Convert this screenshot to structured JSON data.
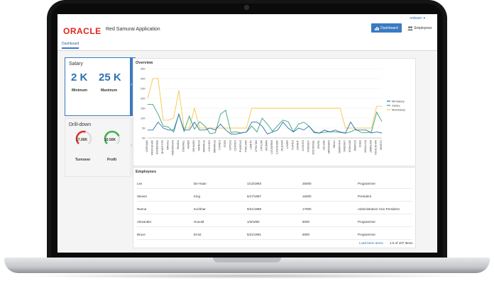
{
  "header": {
    "logo_text": "ORACLE",
    "app_title": "Red Samurai Application",
    "user": "redsam",
    "dashboard_button": "Dashboard",
    "employees_button": "Employees"
  },
  "tabs": {
    "active": "Dashboard"
  },
  "salary": {
    "title": "Salary",
    "minimum_value": "2 K",
    "minimum_label": "Minimum",
    "maximum_value": "25 K",
    "maximum_label": "Maximum"
  },
  "drilldown": {
    "title": "Drill-down",
    "turnover_value": "17.00K",
    "turnover_label": "Turnover",
    "turnover_level": 0.55,
    "profit_value": "10.50K",
    "profit_label": "Profit",
    "profit_level": 0.75
  },
  "chart_data": {
    "type": "line",
    "title": "Overview",
    "ylim": [
      0,
      35000
    ],
    "yticks": [
      "0K",
      "5K",
      "10K",
      "15K",
      "20K",
      "25K",
      "30K",
      "35K"
    ],
    "categories": [
      "LDEHAAN",
      "WKOCHHAR",
      "NGREENBE",
      "BHARTSTE",
      "IMIKKILI",
      "KMOURGOS",
      "SBAIDA",
      "SSEWALL",
      "HBAER",
      "JWHALEN",
      "MWEISS",
      "AMARKLE",
      "KCHUNG",
      "MMARKLE",
      "VJONES",
      "GGEE",
      "SSTILES",
      "CDAVIES",
      "PVARGAS",
      "PWILSON",
      "LSMITH",
      "LPHILTAN",
      "JTAYLOR",
      "SKUMAR",
      "LOCKERKE",
      "CJOHNSON",
      "JFLEAUR",
      "LOZER",
      "TGATES",
      "JGRANT",
      "JLIVINGS",
      "KFEENEY",
      "DOCONNEL",
      "JPATEL",
      "JOLSON",
      "MROGERS",
      "SBULL",
      "SMARVINS",
      "SFEENEY",
      "WTAYLOR",
      "RMATOS",
      "KGEE",
      "MSULLIVA",
      "JAMRLOW",
      "NKOCHHAR",
      "WGIETZ"
    ],
    "series": [
      {
        "name": "MinSalary",
        "color": "#2e6fb0",
        "values": [
          4000,
          4000,
          8000,
          5000,
          4000,
          4000,
          12000,
          4000,
          4000,
          8000,
          4000,
          4000,
          5000,
          4000,
          7000,
          4000,
          2000,
          2000,
          2500,
          3000,
          8000,
          8000,
          6000,
          2000,
          3000,
          4000,
          8000,
          5000,
          3000,
          5000,
          4000,
          6000,
          3000,
          2500,
          4000,
          3000,
          4000,
          3000,
          2500,
          8000,
          4000,
          4000,
          4000,
          2500,
          3000,
          2500
        ]
      },
      {
        "name": "Salary",
        "color": "#3aa37a",
        "values": [
          17000,
          17000,
          12000,
          6000,
          5500,
          2900,
          12000,
          3300,
          11000,
          4400,
          8200,
          6000,
          2200,
          2600,
          12000,
          14000,
          2800,
          3100,
          2500,
          3000,
          6000,
          3000,
          10000,
          7000,
          3400,
          6300,
          9000,
          8200,
          3200,
          7000,
          8000,
          6000,
          2600,
          2500,
          2900,
          3200,
          3100,
          2800,
          2400,
          3100,
          4400,
          2800,
          2600,
          3100,
          13000,
          8300
        ]
      },
      {
        "name": "MaxSalary",
        "color": "#f3c84a",
        "values": [
          20000,
          30000,
          30000,
          9000,
          9000,
          10000,
          24000,
          5000,
          5000,
          15000,
          5000,
          5000,
          5000,
          5000,
          5000,
          5000,
          5000,
          5000,
          5000,
          5000,
          15000,
          15000,
          15000,
          15000,
          15000,
          15000,
          15000,
          15000,
          15000,
          15000,
          15000,
          15000,
          15000,
          15000,
          15000,
          15000,
          15000,
          15000,
          5000,
          5000,
          5000,
          5000,
          5000,
          5000,
          16000,
          16000
        ]
      }
    ]
  },
  "employees": {
    "title": "Employees",
    "rows": [
      [
        "Lex",
        "De Haan",
        "1/13/1993",
        "25000",
        "Programmer"
      ],
      [
        "Steven",
        "King",
        "6/17/1987",
        "16000",
        "President"
      ],
      [
        "Neena",
        "Kochhar",
        "9/21/1989",
        "17000",
        "Administration Vice President"
      ],
      [
        "Alexander",
        "Hunold",
        "1/3/1990",
        "8000",
        "Programmer"
      ],
      [
        "Bruce",
        "Ernst",
        "5/21/1991",
        "6000",
        "Programmer"
      ]
    ],
    "load_more": "Load More Items",
    "count": "1-5 of 107 Items"
  }
}
